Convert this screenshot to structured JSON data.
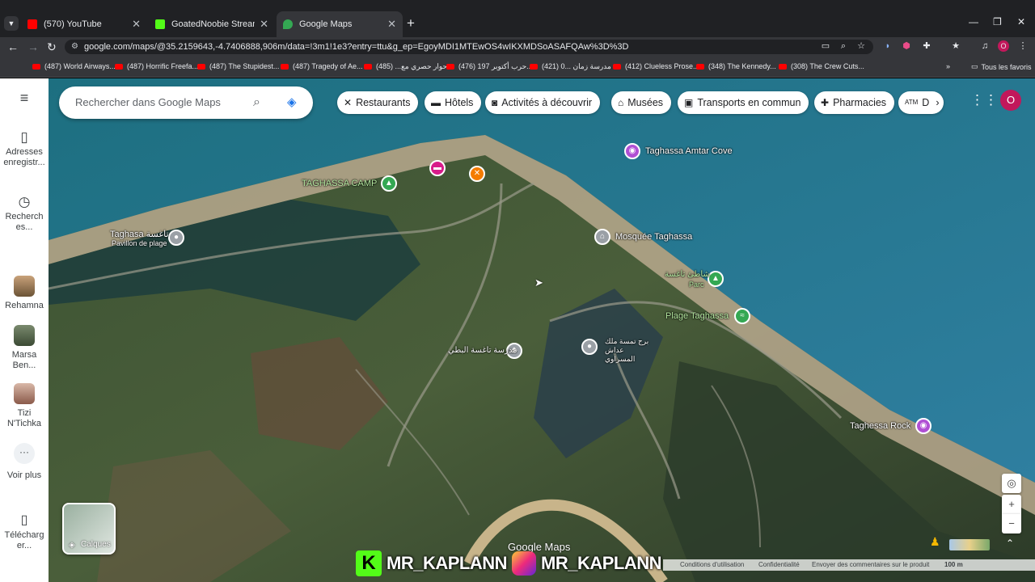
{
  "browser": {
    "tabs": [
      {
        "title": "(570) YouTube",
        "active": false,
        "favicon_color": "#ff0000"
      },
      {
        "title": "GoatedNoobie Stream - Watch",
        "active": false,
        "favicon_color": "#53fc18"
      },
      {
        "title": "Google Maps",
        "active": true,
        "favicon_color": "#34a853"
      }
    ],
    "new_tab": "+",
    "window_controls": {
      "minimize": "—",
      "restore": "❐",
      "close": "✕"
    },
    "url": "google.com/maps/@35.2159643,-4.7406888,906m/data=!3m1!1e3?entry=ttu&g_ep=EgoyMDI1MTEwOS4wIKXMDSoASAFQAw%3D%3D",
    "profile_initial": "O",
    "bookmarks": [
      "(487) World Airways...",
      "(487) Horrific Freefa...",
      "(487) The Stupidest...",
      "(487) Tragedy of Ae...",
      "حوار حصري مع... (485)",
      "(476) حرب أكتوبر 197...",
      "(421) مدرسة زمان ...0",
      "(412) Clueless Prose...",
      "(348) The Kennedy...",
      "(308) The Crew Cuts..."
    ],
    "all_bookmarks": "Tous les favoris"
  },
  "maps": {
    "search_placeholder": "Rechercher dans Google Maps",
    "chips": [
      {
        "label": "Restaurants",
        "icon": "fork-knife-icon"
      },
      {
        "label": "Hôtels",
        "icon": "bed-icon"
      },
      {
        "label": "Activités à découvrir",
        "icon": "camera-icon"
      },
      {
        "label": "Musées",
        "icon": "museum-icon"
      },
      {
        "label": "Transports en commun",
        "icon": "bus-icon"
      },
      {
        "label": "Pharmacies",
        "icon": "pharmacy-icon"
      },
      {
        "label": "D",
        "icon": "atm-icon"
      }
    ],
    "rail": {
      "saved": "Adresses enregistr...",
      "recents": "Recherch es...",
      "recent_places": [
        "Rehamna",
        "Marsa Ben...",
        "Tizi N'Tichka"
      ],
      "more": "Voir plus",
      "download": "Télécharg er..."
    },
    "profile_initial": "O",
    "layers_label": "Calques",
    "places": {
      "amtar_cove": "Taghassa Amtar Cove",
      "camp": "TAGHASSA CAMP",
      "pavilion_name": "Taghasa تاغسة",
      "pavilion_sub": "Pavillon de plage",
      "mosque": "Mosquée Taghassa",
      "park_name": "شاطئ تاغسة",
      "park_sub": "Parc",
      "beach": "Plage Taghassa",
      "school": "مدرسة تاغسة البطي",
      "tower": "برج تمسة ملك عداش المسراوي",
      "rock": "Taghessa Rock"
    },
    "map_watermark": "Google Maps",
    "footer": {
      "terms": "Conditions d'utilisation",
      "privacy": "Confidentialité",
      "feedback": "Envoyer des commentaires sur le produit",
      "scale": "100 m"
    }
  },
  "overlay": {
    "handle1": "MR_KAPLANN",
    "handle2": "MR_KAPLANN"
  }
}
